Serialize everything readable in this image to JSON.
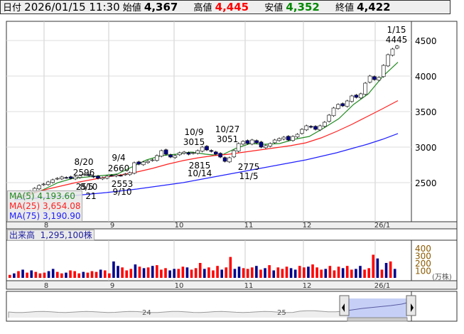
{
  "header": {
    "date_label": "日付",
    "datetime": "2026/01/15 11:30",
    "open_label": "始値",
    "open": "4,367",
    "high_label": "高値",
    "high": "4,445",
    "low_label": "安値",
    "low": "4,352",
    "close_label": "終値",
    "close": "4,422"
  },
  "colors": {
    "up": "#ff0000",
    "down": "#00008b",
    "ma5": "#228b22",
    "ma25": "#ff2020",
    "ma75": "#2020ff",
    "low": "#008000"
  },
  "legend": {
    "ma5_label": "MA(5)",
    "ma5": "4,193.60",
    "ma25_label": "MA(25)",
    "ma25": "3,654.08",
    "ma75_label": "MA(75)",
    "ma75": "3,190.90"
  },
  "volume_label": {
    "label": "出来高",
    "value": "1,295,100株"
  },
  "volume_axis": {
    "ticks": [
      "400",
      "300",
      "200",
      "100"
    ],
    "unit": "(万株)"
  },
  "navigator": {
    "labels": [
      "24",
      "25"
    ]
  },
  "chart_data": {
    "type": "candlestick",
    "price_ticks": [
      "4500",
      "4000",
      "3500",
      "3000",
      "2500"
    ],
    "month_labels": [
      "8",
      "9",
      "10",
      "11",
      "12",
      "26/1"
    ],
    "annotations": [
      {
        "date": "8/20",
        "value": "2596"
      },
      {
        "date": "9/4",
        "value": "2660"
      },
      {
        "date": "10/9",
        "value": "3015"
      },
      {
        "date": "10/27",
        "value": "3051"
      },
      {
        "date": "1/15",
        "value": "4445"
      },
      {
        "date": "9/10",
        "value": "2553"
      },
      {
        "date": "10/14",
        "value": "2815"
      },
      {
        "date": "11/5",
        "value": "2775"
      },
      {
        "date": "8/5",
        "value": "2510"
      },
      {
        "date": "",
        "value": "21"
      }
    ],
    "closes": [
      2300,
      2320,
      2350,
      2380,
      2420,
      2460,
      2480,
      2510,
      2540,
      2560,
      2580,
      2570,
      2560,
      2580,
      2600,
      2620,
      2600,
      2580,
      2560,
      2570,
      2590,
      2600,
      2610,
      2600,
      2620,
      2640,
      2780,
      2760,
      2790,
      2800,
      2820,
      2880,
      2950,
      2900,
      2860,
      2880,
      2920,
      2930,
      2900,
      2920,
      2950,
      3000,
      2960,
      2940,
      2900,
      2860,
      2800,
      2850,
      2950,
      3050,
      3080,
      3050,
      3100,
      3060,
      3000,
      3020,
      3050,
      3100,
      3120,
      3140,
      3100,
      3150,
      3180,
      3250,
      3300,
      3280,
      3250,
      3300,
      3350,
      3450,
      3550,
      3600,
      3580,
      3650,
      3720,
      3700,
      3750,
      3900,
      4000,
      3950,
      3980,
      4150,
      4300,
      4380,
      4422
    ],
    "ma5": [
      2320,
      2400,
      2500,
      2560,
      2580,
      2600,
      2620,
      2720,
      2820,
      2880,
      2900,
      2930,
      2900,
      2880,
      2980,
      3050,
      3040,
      3050,
      3110,
      3150,
      3270,
      3400,
      3600,
      3750,
      4000,
      4194
    ],
    "ma25": [
      2300,
      2340,
      2400,
      2450,
      2500,
      2540,
      2580,
      2610,
      2650,
      2700,
      2760,
      2810,
      2850,
      2880,
      2900,
      2930,
      2960,
      2990,
      3020,
      3060,
      3130,
      3220,
      3320,
      3430,
      3540,
      3654
    ],
    "ma75": [
      2260,
      2275,
      2290,
      2305,
      2320,
      2340,
      2360,
      2385,
      2410,
      2440,
      2470,
      2500,
      2540,
      2580,
      2620,
      2660,
      2700,
      2740,
      2780,
      2820,
      2870,
      2920,
      2980,
      3040,
      3110,
      3191
    ],
    "volumes": [
      40,
      60,
      90,
      110,
      70,
      100,
      80,
      60,
      70,
      90,
      120,
      80,
      60,
      70,
      100,
      90,
      60,
      80,
      70,
      90,
      80,
      110,
      100,
      60,
      220,
      160,
      140,
      100,
      120,
      180,
      150,
      130,
      140,
      160,
      170,
      110,
      130,
      100,
      120,
      120,
      150,
      140,
      110,
      130,
      200,
      120,
      140,
      100,
      160,
      110,
      140,
      280,
      120,
      150,
      130,
      120,
      140,
      160,
      110,
      130,
      170,
      100,
      140,
      120,
      150,
      130,
      110,
      160,
      140,
      150,
      180,
      140,
      110,
      120,
      160,
      100,
      150,
      130,
      160,
      110,
      120,
      160,
      110,
      130,
      310,
      260,
      110,
      200,
      220,
      120
    ]
  }
}
